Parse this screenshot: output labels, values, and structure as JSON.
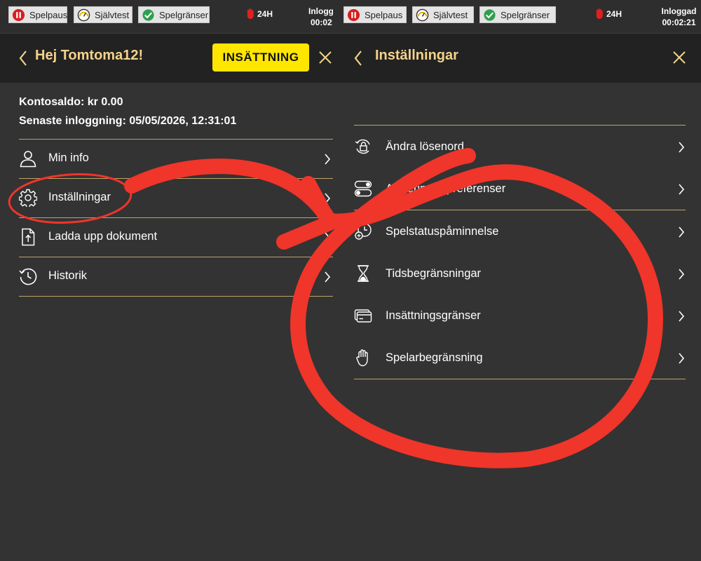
{
  "topbar": {
    "pause_label": "Spelpaus",
    "selftest_label": "Självtest",
    "limits_label": "Spelgränser",
    "badge_24h": "24H",
    "logged_in_label": "Inloggad",
    "left_time": "00:02:",
    "right_time": "00:02:21"
  },
  "left_panel": {
    "greeting": "Hej Tomtoma12!",
    "deposit_label": "INSÄTTNING",
    "balance": "Kontosaldo: kr 0.00",
    "last_login": "Senaste inloggning: 05/05/2026, 12:31:01",
    "menu": [
      {
        "label": "Min info",
        "icon": "user-icon"
      },
      {
        "label": "Inställningar",
        "icon": "gear-icon"
      },
      {
        "label": "Ladda upp dokument",
        "icon": "upload-document-icon"
      },
      {
        "label": "Historik",
        "icon": "history-icon"
      }
    ]
  },
  "right_panel": {
    "title": "Inställningar",
    "menu": [
      {
        "label": "Ändra lösenord",
        "icon": "lock-refresh-icon"
      },
      {
        "label": "Aviseringar/preferenser",
        "icon": "toggle-icon"
      },
      {
        "label": "Spelstatuspåminnelse",
        "icon": "clock-reminder-icon"
      },
      {
        "label": "Tidsbegränsningar",
        "icon": "hourglass-icon"
      },
      {
        "label": "Insättningsgränser",
        "icon": "credit-card-icon"
      },
      {
        "label": "Spelarbegränsning",
        "icon": "hand-stop-icon"
      }
    ]
  },
  "colors": {
    "background": "#333333",
    "header": "#222222",
    "accent_gold": "#f3d38a",
    "separator": "#bfa36b",
    "deposit_yellow": "#ffe600",
    "annotation_red": "#f0352a"
  }
}
